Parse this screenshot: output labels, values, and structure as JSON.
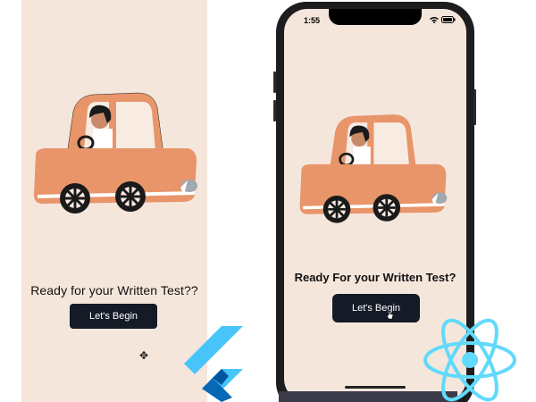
{
  "left_app": {
    "title": "Ready for your Written Test??",
    "button_label": "Let's Begin",
    "cursor_glyph": "✥",
    "framework_logo": "flutter-logo"
  },
  "right_app": {
    "status_time": "1:55",
    "title": "Ready For your Written Test?",
    "button_label": "Let's Begin",
    "framework_logo": "react-logo"
  },
  "colors": {
    "screen_background": "#f5e6dc",
    "button_background": "#141a26",
    "car_body": "#e8956a",
    "flutter_blue": "#4fc3f7",
    "react_blue": "#61dafb"
  }
}
